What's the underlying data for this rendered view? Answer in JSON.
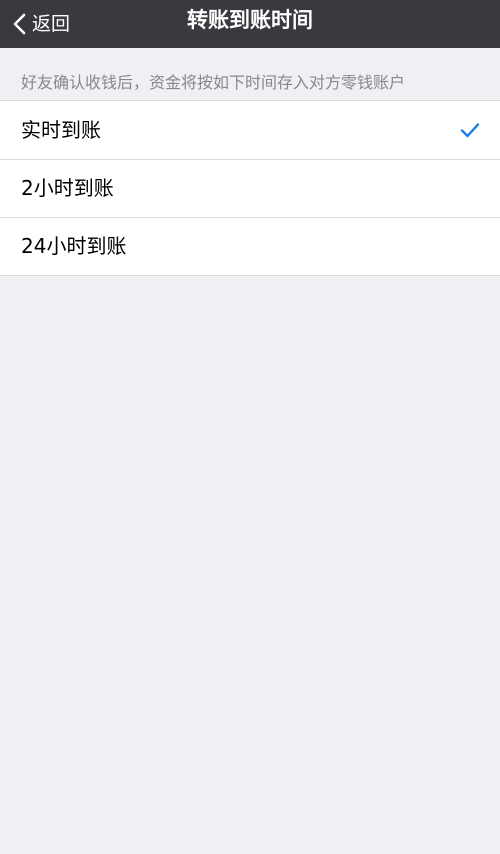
{
  "navbar": {
    "back_label": "返回",
    "title": "转账到账时间"
  },
  "hint": "好友确认收钱后，资金将按如下时间存入对方零钱账户",
  "options": [
    {
      "label": "实时到账",
      "selected": true
    },
    {
      "label": "2小时到账",
      "selected": false
    },
    {
      "label": "24小时到账",
      "selected": false
    }
  ],
  "colors": {
    "navbar_bg": "#393a3f",
    "page_bg": "#efeff4",
    "check": "#1a7de6",
    "hint_text": "#888888"
  }
}
